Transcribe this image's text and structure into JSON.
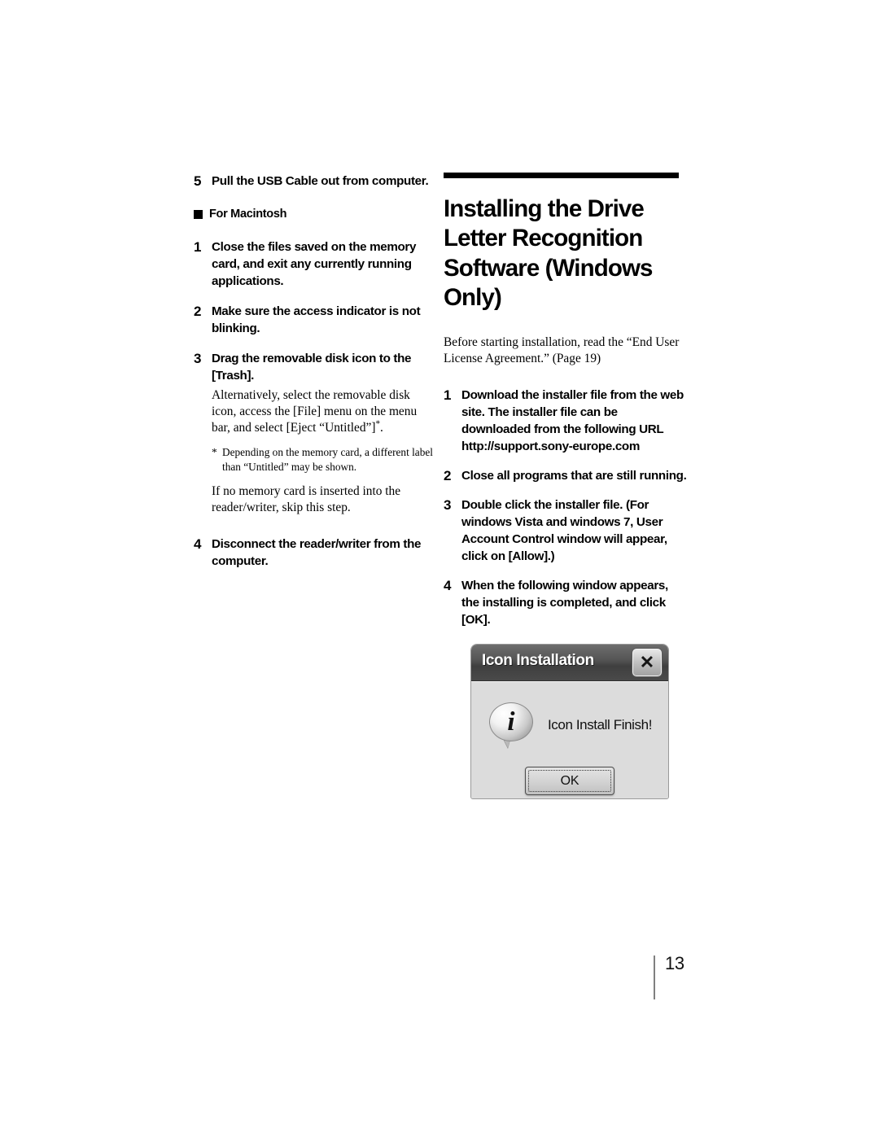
{
  "left_column": {
    "steps_before": [
      {
        "num": "5",
        "title": "Pull the USB Cable out from computer."
      }
    ],
    "section": {
      "bullet_label": "For Macintosh"
    },
    "steps": [
      {
        "num": "1",
        "title": "Close the files saved on the memory card, and exit any currently running applications."
      },
      {
        "num": "2",
        "title": "Make sure the access indicator is not blinking."
      },
      {
        "num": "3",
        "title": "Drag the removable disk icon to the [Trash]."
      },
      {
        "num": "4",
        "title": "Disconnect the reader/writer from the computer."
      }
    ],
    "step3_body_part1": "Alternatively, select the removable disk icon, access the [File] menu on the menu bar, and select [Eject “Untitled”]",
    "step3_body_part2": ".",
    "footnote_mark": "*",
    "footnote_text": "Depending on the memory card, a different label than “Untitled” may be shown.",
    "note_text": "If no memory card is inserted into the reader/writer, skip this step."
  },
  "right_column": {
    "heading": "Installing the Drive Letter Recognition Software (Windows Only)",
    "intro": "Before starting installation, read the “End User License Agreement.” (Page 19)",
    "steps": [
      {
        "num": "1",
        "title": "Download the installer file from the web site. The installer file can be downloaded from the following URL http://support.sony-europe.com"
      },
      {
        "num": "2",
        "title": "Close all programs that are still running."
      },
      {
        "num": "3",
        "title": "Double click the installer file. (For windows Vista and windows 7, User Account Control window will appear, click on [Allow].)"
      },
      {
        "num": "4",
        "title": "When the following window appears, the installing is completed, and click [OK]."
      }
    ]
  },
  "dialog": {
    "title": "Icon Installation",
    "close_label": "✕",
    "info_letter": "i",
    "message": "Icon Install Finish!",
    "ok_label": "OK"
  },
  "footer": {
    "page_number": "13"
  }
}
